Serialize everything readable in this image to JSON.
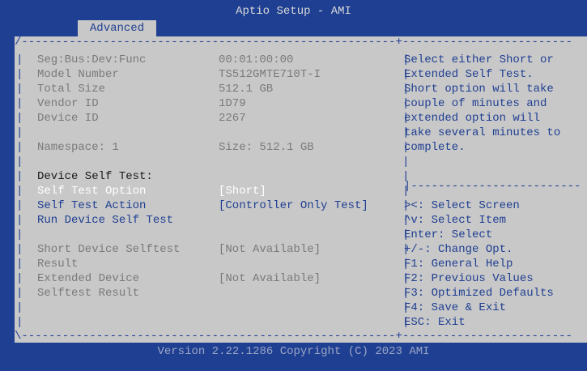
{
  "app": {
    "title": "Aptio Setup - AMI",
    "footer": "Version 2.22.1286 Copyright (C) 2023 AMI"
  },
  "tabs": [
    {
      "label": "Advanced"
    }
  ],
  "info": [
    {
      "label": "Seg:Bus:Dev:Func",
      "value": "00:01:00:00"
    },
    {
      "label": "Model Number",
      "value": "TS512GMTE710T-I"
    },
    {
      "label": "Total Size",
      "value": "512.1 GB"
    },
    {
      "label": "Vendor ID",
      "value": "1D79"
    },
    {
      "label": "Device ID",
      "value": "2267"
    }
  ],
  "namespace": {
    "label": "Namespace: 1",
    "value": "Size: 512.1 GB"
  },
  "self_test": {
    "heading": "Device Self Test:",
    "option_label": "Self Test Option",
    "option_value": "[Short]",
    "action_label": "Self Test Action",
    "action_value": "[Controller Only Test]",
    "run_label": "Run Device Self Test"
  },
  "results": {
    "short_label_1": "Short Device Selftest",
    "short_label_2": "Result",
    "short_value": "[Not Available]",
    "extended_label_1": "Extended Device",
    "extended_label_2": "Selftest Result",
    "extended_value": "[Not Available]"
  },
  "help": {
    "description": [
      "Select either Short or",
      "Extended Self Test.",
      "Short option will take",
      "couple of minutes and",
      "extended option will",
      "take several minutes to",
      "complete."
    ],
    "keys": [
      "><: Select Screen",
      "^v: Select Item",
      "Enter: Select",
      "+/-: Change Opt.",
      "F1: General Help",
      "F2: Previous Values",
      "F3: Optimized Defaults",
      "F4: Save & Exit",
      "ESC: Exit"
    ]
  },
  "colors": {
    "background": "#1f3f92",
    "panel": "#c8c8c8",
    "selected": "#ffffff"
  }
}
